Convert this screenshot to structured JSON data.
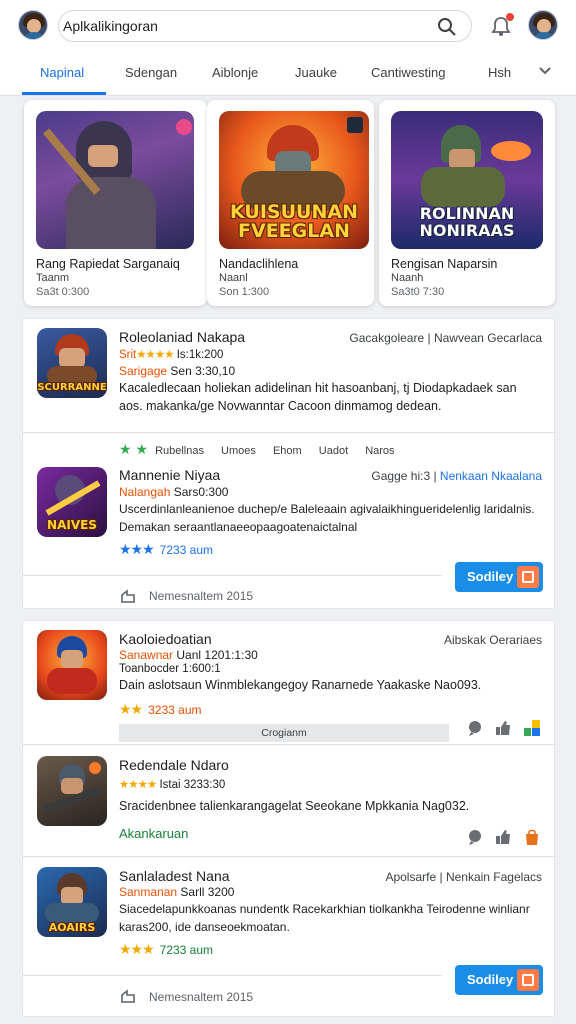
{
  "header": {
    "search_value": "Aplkalikingoran",
    "search_icon": "search-icon",
    "bell_icon": "bell-icon"
  },
  "tabs": [
    {
      "label": "Napinal",
      "active": true
    },
    {
      "label": "Sdengan"
    },
    {
      "label": "Aiblonje"
    },
    {
      "label": "Juauke"
    },
    {
      "label": "Cantiwesting"
    },
    {
      "label": "Hsh"
    }
  ],
  "featured": [
    {
      "title": "Rang Rapiedat Sarganaiq",
      "subtitle": "Taanm",
      "meta": "Sa3t 0:300",
      "art_text": ""
    },
    {
      "title": "Nandaclihlena",
      "subtitle": "Naanl",
      "meta": "Son 1:300",
      "art_text": "KUISUUNAN FVEEGLAN"
    },
    {
      "title": "Rengisan Naparsin",
      "subtitle": "Naanh",
      "meta": "Sa3t0 7:30",
      "art_text": "ROLINNAN NONIRAAS"
    }
  ],
  "list": [
    {
      "name": "Roleolaniad Nakapa",
      "dev1": "Srit",
      "rating_line": "Is:1k:200",
      "dev2": "Sarigage",
      "dev2b": "Sen 3:30,10",
      "meta_left": "Gacakgoleare",
      "meta_right": "Nawvean Gecarlaca",
      "desc": "Kacaledlecaan holiekan adidelinan hit hasoanbanj, tj Diodapkadaek san aos. makanka/ge Novwanntar Cacoon dinmamog dedean.",
      "art_text": "SCURRANNE",
      "categories": [
        "Rubellnas",
        "Umoes",
        "Ehom",
        "Uadot",
        "Naros"
      ]
    },
    {
      "name": "Mannenie Niyaa",
      "dev1": "Nalangah",
      "rating_line": "Sars0:300",
      "meta_left": "Gagge hi:3",
      "meta_right": "Nenkaan Nkaalana",
      "desc": "Uscerdinlanleanienoe duchep/e Baleleaain agivalaikhingueridelenlig laridalnis. Demakan seraantlanaeeopaagoatenaictalnal",
      "art_text": "NAIVES",
      "rating": "7233 aum",
      "button": "Sodiley",
      "footer": "Nemesnaltem 2015"
    },
    {
      "name": "Kaoloiedoatian",
      "dev1": "Sanawnar",
      "rating_line": "Uanl 1201:1:30",
      "subline": "Toanbocder 1:600:1",
      "meta_right": "Aibskak Oerariaes",
      "desc": "Dain aslotsaun Winmblekangegoy Ranarnede Yaakaske Nao093.",
      "rating": "3233 aum",
      "bar": "Crogianm"
    },
    {
      "name": "Redendale Ndaro",
      "rating_line": "Istai 3233:30",
      "desc": "Sracidenbnee talienkarangagelat Seeokane Mpkkania Nag032.",
      "green": "Akankaruan"
    },
    {
      "name": "Sanlaladest Nana",
      "dev1": "Sanmanan",
      "rating_line": "Sarll 3200",
      "meta_left": "Apolsarfe",
      "meta_right": "Nenkain Fagelacs",
      "desc": "Siacedelapunkkoanas nundentk Racekarkhian tiolkankha Teirodenne winlianr karas200, ide danseoekmoatan.",
      "art_text": "AOAIRS",
      "rating": "7233 aum",
      "button": "Sodiley",
      "footer": "Nemesnaltem 2015"
    }
  ],
  "colors": {
    "accent": "#1a73e8",
    "star": "#f4a900",
    "green_star": "#34a853",
    "button": "#1a8de8"
  }
}
